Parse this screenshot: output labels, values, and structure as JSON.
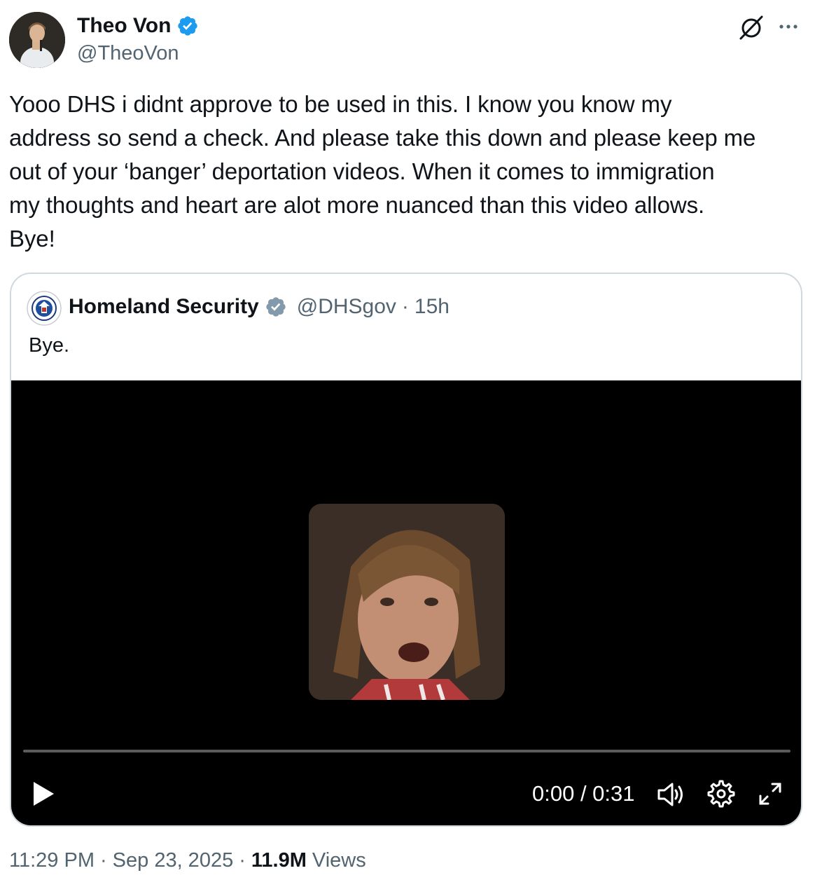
{
  "author": {
    "display_name": "Theo Von",
    "handle": "@TheoVon"
  },
  "tweet": {
    "text": "Yooo DHS i didnt approve to be used in this. I know you know my\naddress so send a check. And please take this down and please keep me\nout of your ‘banger’ deportation videos. When it comes to immigration\nmy thoughts and heart are alot more nuanced than this video allows.\nBye!"
  },
  "quote": {
    "display_name": "Homeland Security",
    "handle": "@DHSgov",
    "separator": "·",
    "time": "15h",
    "text": "Bye.",
    "video": {
      "time_readout": "0:00 / 0:31",
      "progress": 0
    }
  },
  "meta": {
    "time": "11:29 PM",
    "separator": "·",
    "date": "Sep 23, 2025",
    "views_count": "11.9M",
    "views_label": "Views"
  },
  "colors": {
    "verified_blue": "#1d9bf0",
    "verified_gray": "#829aab",
    "secondary_text": "#536471",
    "border": "#cfd9de"
  },
  "icons": [
    "verified-badge-icon",
    "grok-icon",
    "more-icon",
    "play-icon",
    "volume-icon",
    "settings-icon",
    "fullscreen-icon"
  ]
}
